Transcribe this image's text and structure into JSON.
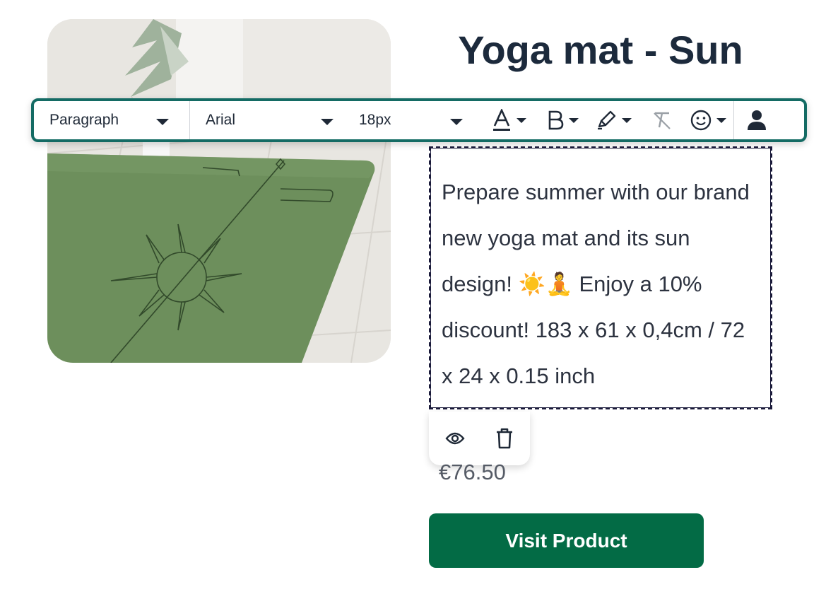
{
  "product": {
    "title": "Yoga mat - Sun",
    "description_part1": "Prepare summer with our brand new yoga mat and its sun design!",
    "emoji_sun": "☀️",
    "emoji_yoga": "🧘",
    "description_part2": "Enjoy a 10% discount! 183 x 61 x 0,4cm / 72 x 24 x 0.15 inch",
    "price": "€76.50",
    "visit_button": "Visit Product"
  },
  "toolbar": {
    "block_format": "Paragraph",
    "font_family": "Arial",
    "font_size": "18px",
    "icons": [
      "font-color-icon",
      "bold-icon",
      "highlighter-icon",
      "clear-format-icon",
      "emoji-icon",
      "user-icon"
    ]
  },
  "popup": {
    "icons": [
      "eye-icon",
      "trash-icon"
    ]
  },
  "colors": {
    "toolbar_border": "#146b64",
    "button_bg": "#036b45",
    "title": "#1c2a3c"
  }
}
